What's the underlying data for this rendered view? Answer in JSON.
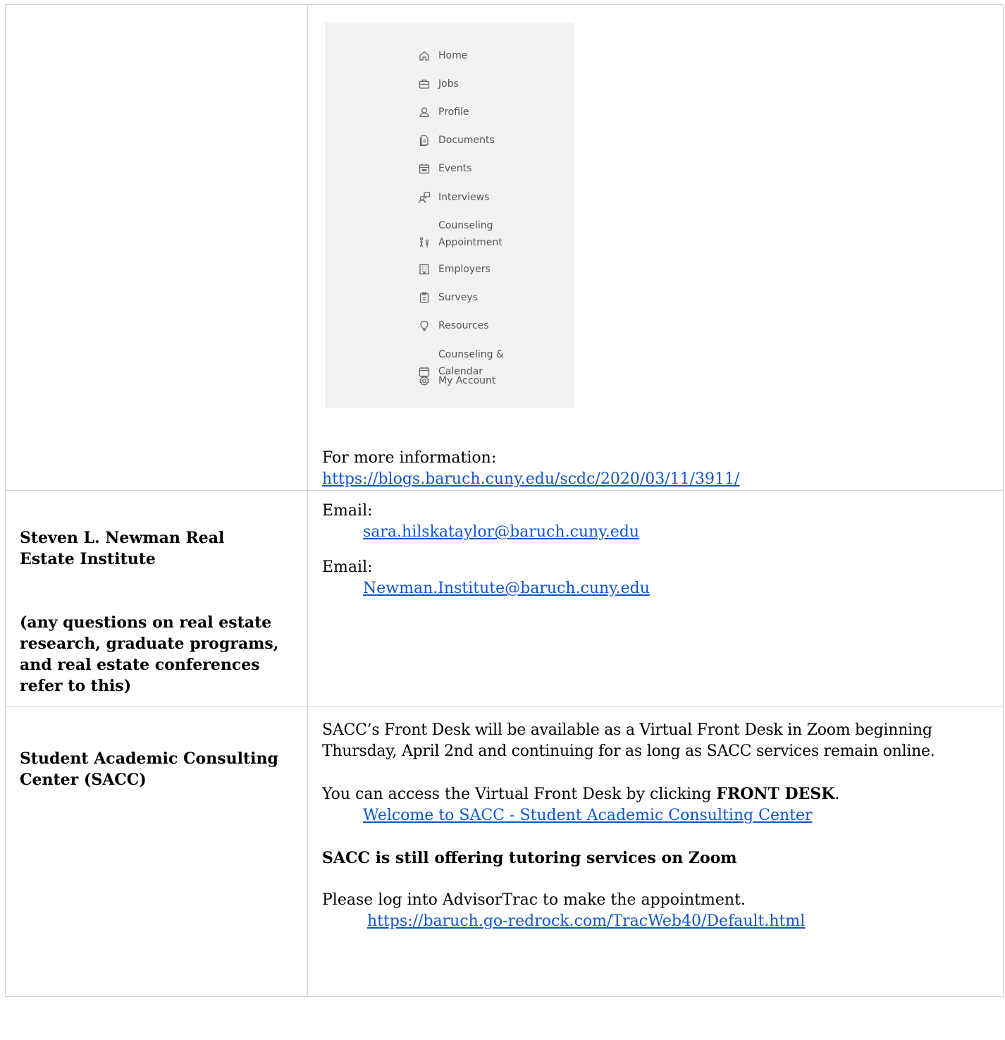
{
  "menu": {
    "items": [
      {
        "label": "Home",
        "icon": "home-icon"
      },
      {
        "label": "Jobs",
        "icon": "briefcase-icon"
      },
      {
        "label": "Profile",
        "icon": "user-icon"
      },
      {
        "label": "Documents",
        "icon": "document-icon"
      },
      {
        "label": "Events",
        "icon": "calendar-event-icon"
      },
      {
        "label": "Interviews",
        "icon": "interview-icon"
      },
      {
        "label": "Counseling\nAppointment",
        "icon": "counseling-icon"
      },
      {
        "label": "Employers",
        "icon": "building-icon"
      },
      {
        "label": "Surveys",
        "icon": "clipboard-icon"
      },
      {
        "label": "Resources",
        "icon": "lightbulb-icon"
      },
      {
        "label": "Counseling &\nCalendar",
        "icon": "calendar-icon"
      },
      {
        "label": "My Account",
        "icon": "gear-icon"
      }
    ]
  },
  "row1": {
    "info_label": "For more information:",
    "info_link": "https://blogs.baruch.cuny.edu/scdc/2020/03/11/3911/"
  },
  "row2": {
    "title": "Steven L. Newman Real Estate Institute",
    "note": "(any questions on real estate research, graduate programs, and real estate conferences refer to this)",
    "email_label_1": "Email:",
    "email_1": "sara.hilskataylor@baruch.cuny.edu",
    "email_label_2": "Email:",
    "email_2": "Newman.Institute@baruch.cuny.edu"
  },
  "row3": {
    "title": "Student Academic Consulting Center (SACC)",
    "para1": "SACC’s Front Desk will be available as a Virtual Front Desk in Zoom beginning Thursday, April 2nd and continuing for as long as SACC services remain online.",
    "para2_prefix": "You can access the Virtual Front Desk by clicking ",
    "para2_bold": "FRONT DESK",
    "para2_suffix": ".",
    "link1": "Welcome to SACC - Student Academic Consulting Center",
    "heading": "SACC is still offering tutoring services on Zoom",
    "para3": "Please log into AdvisorTrac to make the appointment.",
    "link2": "https://baruch.go-redrock.com/TracWeb40/Default.html"
  }
}
